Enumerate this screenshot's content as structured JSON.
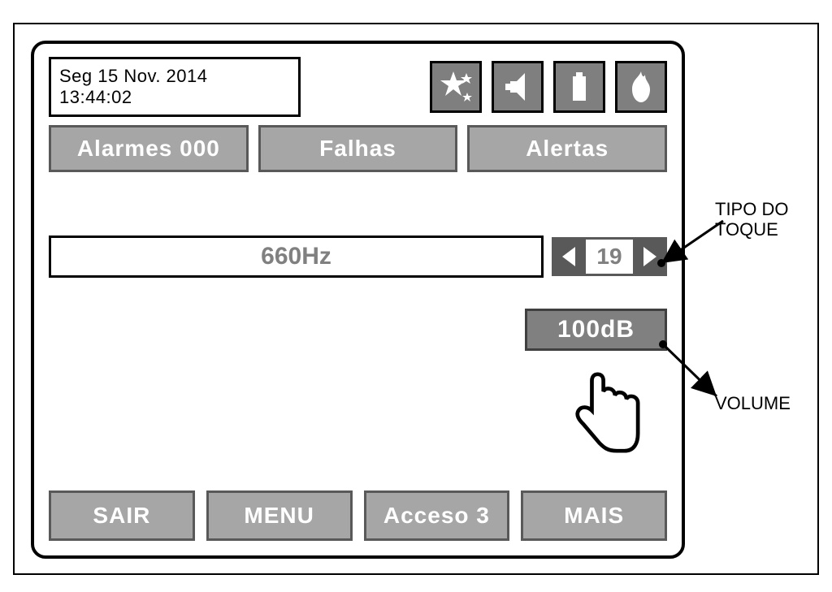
{
  "datetime": {
    "date": "Seg 15 Nov. 2014",
    "time": "13:44:02"
  },
  "header_icons": {
    "star": "star-icon",
    "speaker": "speaker-icon",
    "battery": "battery-icon",
    "flame": "flame-icon"
  },
  "tabs": {
    "alarms": "Alarmes 000",
    "faults": "Falhas",
    "alerts": "Alertas"
  },
  "ringtone": {
    "frequency": "660Hz",
    "index": "19"
  },
  "volume": {
    "label": "100dB"
  },
  "footer": {
    "exit": "SAIR",
    "menu": "MENU",
    "access": "Acceso 3",
    "more": "MAIS"
  },
  "annotations": {
    "ring_type": "TIPO DO\nTOQUE",
    "volume": "VOLUME"
  }
}
